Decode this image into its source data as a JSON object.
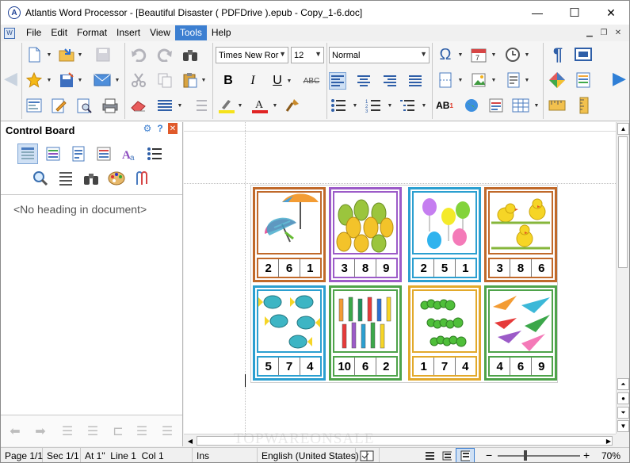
{
  "window": {
    "title": "Atlantis Word Processor - [Beautiful Disaster ( PDFDrive ).epub - Copy_1-6.doc]",
    "controls": {
      "minimize": "—",
      "maximize": "☐",
      "close": "✕"
    }
  },
  "menu": [
    "File",
    "Edit",
    "Format",
    "Insert",
    "View",
    "Tools",
    "Help"
  ],
  "menu_active": "Tools",
  "toolbar": {
    "font_name": "Times New Ror",
    "font_size": "12",
    "style": "Normal",
    "bold": "B",
    "italic": "I",
    "underline": "U",
    "strike": "ABC",
    "superscript": "AB",
    "superscript_mark": "1"
  },
  "control_board": {
    "title": "Control Board",
    "empty_text": "<No heading in document>"
  },
  "document": {
    "watermark": "TOPWAREONSALE",
    "cards": [
      {
        "picture": "umbrella-icon",
        "numbers": [
          "2",
          "6",
          "1"
        ],
        "color": "#c0692a"
      },
      {
        "picture": "pear-icon",
        "numbers": [
          "3",
          "8",
          "9"
        ],
        "color": "#9c5bc8"
      },
      {
        "picture": "balloon-icon",
        "numbers": [
          "2",
          "5",
          "1"
        ],
        "color": "#2b9fd0"
      },
      {
        "picture": "chick-icon",
        "numbers": [
          "3",
          "8",
          "6"
        ],
        "color": "#c0692a"
      },
      {
        "picture": "fish-icon",
        "numbers": [
          "5",
          "7",
          "4"
        ],
        "color": "#2b9fd0"
      },
      {
        "picture": "pencil-icon",
        "numbers": [
          "10",
          "6",
          "2"
        ],
        "color": "#4ea34a"
      },
      {
        "picture": "caterpillar-icon",
        "numbers": [
          "1",
          "7",
          "4"
        ],
        "color": "#e2a92b"
      },
      {
        "picture": "paper-plane-icon",
        "numbers": [
          "4",
          "6",
          "9"
        ],
        "color": "#4ea34a"
      }
    ]
  },
  "status": {
    "page": "Page 1/1",
    "section": "Sec 1/1",
    "position": "At 1\"  Line 1  Col 1",
    "mode": "Ins",
    "language": "English (United States)",
    "zoom": "70%",
    "zoom_minus": "−",
    "zoom_plus": "+"
  }
}
